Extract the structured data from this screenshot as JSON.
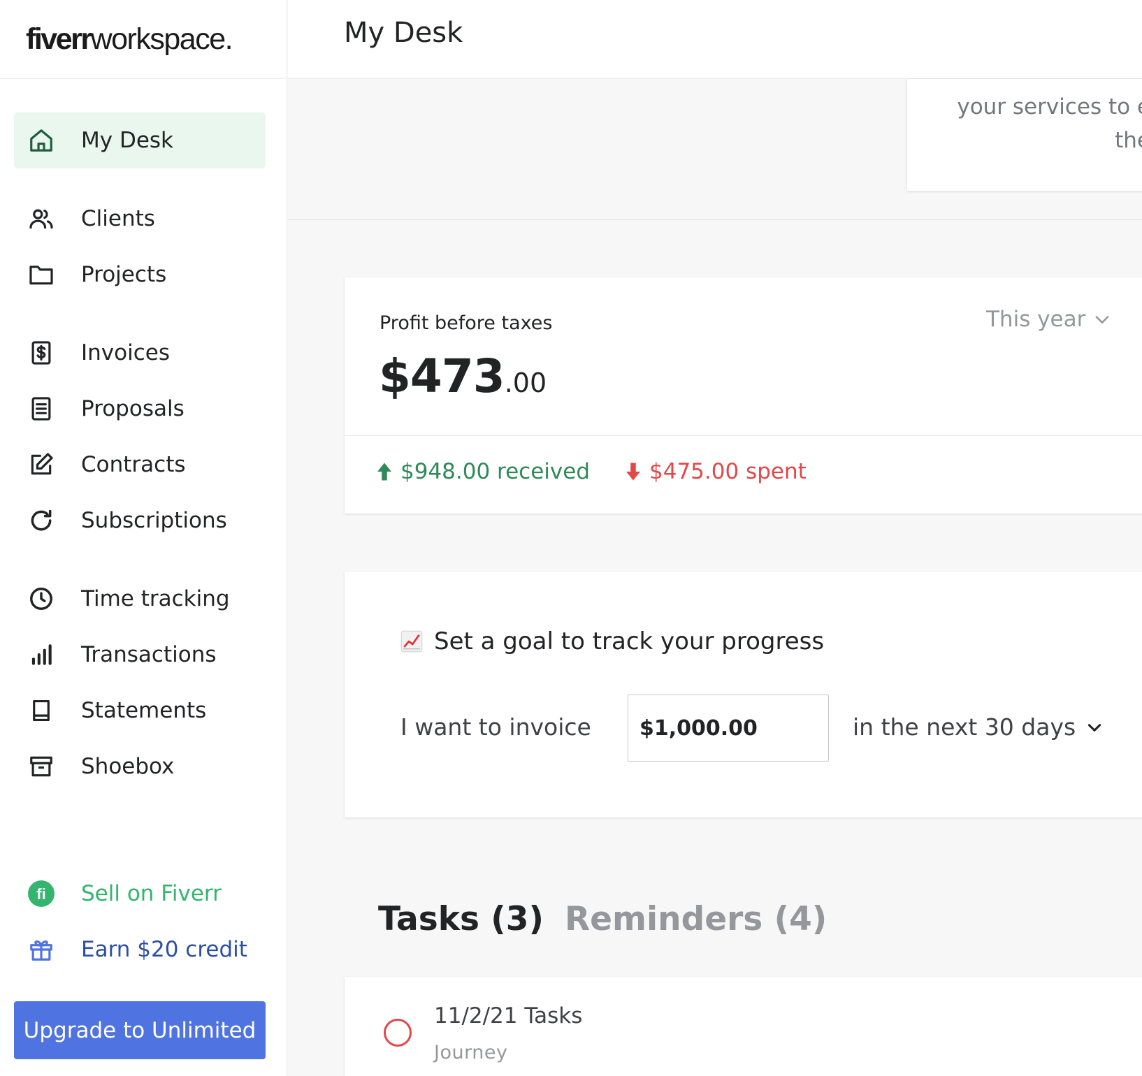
{
  "brand": {
    "logo_brand": "fiverr",
    "logo_rest": "workspace."
  },
  "header": {
    "title": "My Desk"
  },
  "sidebar": {
    "items": [
      {
        "label": "My Desk",
        "icon": "home-icon",
        "active": true
      },
      {
        "label": "Clients",
        "icon": "users-icon"
      },
      {
        "label": "Projects",
        "icon": "folder-icon"
      },
      {
        "label": "Invoices",
        "icon": "invoice-dollar-icon"
      },
      {
        "label": "Proposals",
        "icon": "document-icon"
      },
      {
        "label": "Contracts",
        "icon": "edit-icon"
      },
      {
        "label": "Subscriptions",
        "icon": "refresh-icon"
      },
      {
        "label": "Time tracking",
        "icon": "clock-icon"
      },
      {
        "label": "Transactions",
        "icon": "bar-chart-icon"
      },
      {
        "label": "Statements",
        "icon": "book-icon"
      },
      {
        "label": "Shoebox",
        "icon": "archive-box-icon"
      }
    ],
    "sell": {
      "label": "Sell on Fiverr",
      "icon": "fiverr-logo-icon",
      "color": "#33b56e"
    },
    "earn": {
      "label": "Earn $20 credit",
      "icon": "gift-icon",
      "color": "#2d4fa3"
    },
    "upgrade_label": "Upgrade to Unlimited"
  },
  "promo": {
    "line1": "your services to e",
    "line2": "the"
  },
  "profit": {
    "label": "Profit before taxes",
    "amount_whole": "$473",
    "amount_cents": ".00",
    "period": "This year",
    "received": "$948.00 received",
    "spent": "$475.00 spent"
  },
  "goal": {
    "emoji": "chart-increasing-icon",
    "title": "Set a goal to track your progress",
    "prefix": "I want to invoice",
    "amount": "$1,000.00",
    "period": "in the next 30 days"
  },
  "tasks": {
    "tab_tasks": "Tasks (3)",
    "tab_reminders": "Reminders (4)",
    "items": [
      {
        "title": "11/2/21 Tasks",
        "project": "Journey"
      }
    ]
  },
  "colors": {
    "accent": "#4f73e0",
    "positive": "#2e8b57",
    "negative": "#e24848",
    "active_bg": "#e9f7ef"
  }
}
